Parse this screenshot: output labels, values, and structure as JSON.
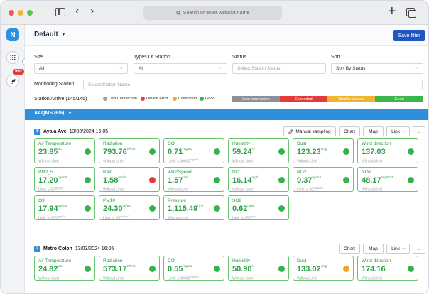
{
  "browser": {
    "url_placeholder": "Search or enter website name",
    "back": "‹",
    "forward": "›",
    "new_tab": "+"
  },
  "rail": {
    "logo": "N",
    "notification_badge": "99+"
  },
  "header": {
    "title": "Default",
    "save_label": "Save filter"
  },
  "filters": {
    "site": {
      "label": "Site",
      "value": "All"
    },
    "types": {
      "label": "Types Of Station",
      "value": "All"
    },
    "status": {
      "label": "Status",
      "placeholder": "Select Station Status"
    },
    "sort": {
      "label": "Sort",
      "value": "Sort By Status"
    },
    "monitoring": {
      "label": "Monitoring Station:",
      "placeholder": "Select Station Name"
    }
  },
  "legend": {
    "active_label": "Station Active (145/145)",
    "items": [
      {
        "label": "Lost Connection",
        "color": "#9aa0a8"
      },
      {
        "label": "Device Error",
        "color": "#e23b3b"
      },
      {
        "label": "Calibration",
        "color": "#e9a92a"
      },
      {
        "label": "Good",
        "color": "#35b24a"
      }
    ],
    "bar": [
      {
        "label": "Lost connection",
        "color": "#8a8f99"
      },
      {
        "label": "Exceeded",
        "color": "#e43a3a"
      },
      {
        "label": "Tend to exceed",
        "color": "#f0b52e"
      },
      {
        "label": "Good",
        "color": "#3cb54b"
      }
    ]
  },
  "group": {
    "title": "AAQMS (6/6)",
    "caret": "▾"
  },
  "stations": [
    {
      "number": "1",
      "name": "Ayala Ave",
      "time": "13/03/2024 16:05",
      "buttons": {
        "manual": "Manual sampling",
        "chart": "Chart",
        "map": "Map",
        "link": "Link",
        "more": "..."
      },
      "cards": [
        {
          "name": "Air Temperature",
          "value": "23.85",
          "unit": "oC",
          "limit": "Without Limit",
          "limit_unit": "",
          "status": "#35b24a"
        },
        {
          "name": "Radiation",
          "value": "793.76",
          "unit": "W/m2",
          "limit": "Without Limit",
          "limit_unit": "",
          "status": "#35b24a"
        },
        {
          "name": "CO",
          "value": "0.71",
          "unit": "mg/m3",
          "limit": "Limit: ≤ 30000",
          "limit_unit": "mg/m3",
          "status": "#35b24a"
        },
        {
          "name": "Humidity",
          "value": "59.24",
          "unit": "%",
          "limit": "Without Limit",
          "limit_unit": "",
          "status": "#35b24a"
        },
        {
          "name": "Dust",
          "value": "123.23",
          "unit": "umg",
          "limit": "Without Limit",
          "limit_unit": "",
          "status": "#35b24a"
        },
        {
          "name": "Wind direction",
          "value": "137.03",
          "unit": "°",
          "limit": "Without Limit",
          "limit_unit": "",
          "status": "#35b24a"
        },
        {
          "name": "PM2_5",
          "value": "17.20",
          "unit": "ug/m3",
          "limit": "Limit: ≤ 50",
          "limit_unit": "ug/m3",
          "status": "#35b24a"
        },
        {
          "name": "Rain",
          "value": "1.58",
          "unit": "mm/h",
          "limit": "Without Limit",
          "limit_unit": "",
          "status": "#e23b3b"
        },
        {
          "name": "WindSpeed",
          "value": "1.57",
          "unit": "m/s",
          "limit": "Without Limit",
          "limit_unit": "",
          "status": "#35b24a"
        },
        {
          "name": "NO",
          "value": "16.14",
          "unit": "mg/L",
          "limit": "Without Limit",
          "limit_unit": "",
          "status": "#35b24a"
        },
        {
          "name": "NO2",
          "value": "9.37",
          "unit": "ug/m3",
          "limit": "Limit: ≤ 200",
          "limit_unit": "ug/m3",
          "status": "#35b24a"
        },
        {
          "name": "NOx",
          "value": "48.17",
          "unit": "mg/Nm3",
          "limit": "Without Limit",
          "limit_unit": "",
          "status": "#35b24a"
        },
        {
          "name": "O3",
          "value": "17.94",
          "unit": "ug/m3",
          "limit": "Limit: ≤ 200",
          "limit_unit": "ug/m3",
          "status": "#35b24a"
        },
        {
          "name": "PM10",
          "value": "24.30",
          "unit": "ug/m3",
          "limit": "Limit: ≤ 100",
          "limit_unit": "ug/m3",
          "status": "#35b24a"
        },
        {
          "name": "Pressure",
          "value": "1,115.49",
          "unit": "hPa",
          "limit": "Without Limit",
          "limit_unit": "",
          "status": "#35b24a"
        },
        {
          "name": "SO2",
          "value": "0.62",
          "unit": "mg/L",
          "limit": "Limit: ≤ 350",
          "limit_unit": "mg/L",
          "status": "#35b24a"
        }
      ]
    },
    {
      "number": "2",
      "name": "Metro Colon",
      "time": "13/03/2024 16:05",
      "buttons": {
        "chart": "Chart",
        "map": "Map",
        "link": "Link",
        "more": "..."
      },
      "cards": [
        {
          "name": "Air Temperature",
          "value": "24.82",
          "unit": "oC",
          "limit": "Without Limit",
          "limit_unit": "",
          "status": "#35b24a"
        },
        {
          "name": "Radiation",
          "value": "573.17",
          "unit": "W/m2",
          "limit": "Without Limit",
          "limit_unit": "",
          "status": "#35b24a"
        },
        {
          "name": "CO",
          "value": "0.55",
          "unit": "mg/m3",
          "limit": "Limit: ≤ 30000",
          "limit_unit": "mg/m3",
          "status": "#35b24a"
        },
        {
          "name": "Humidity",
          "value": "50.90",
          "unit": "%",
          "limit": "Without Limit",
          "limit_unit": "",
          "status": "#35b24a"
        },
        {
          "name": "Dust",
          "value": "133.02",
          "unit": "umg",
          "limit": "Without Limit",
          "limit_unit": "",
          "status": "#e9a92a"
        },
        {
          "name": "Wind direction",
          "value": "174.16",
          "unit": "°",
          "limit": "Without Limit",
          "limit_unit": "",
          "status": "#35b24a"
        }
      ]
    }
  ]
}
